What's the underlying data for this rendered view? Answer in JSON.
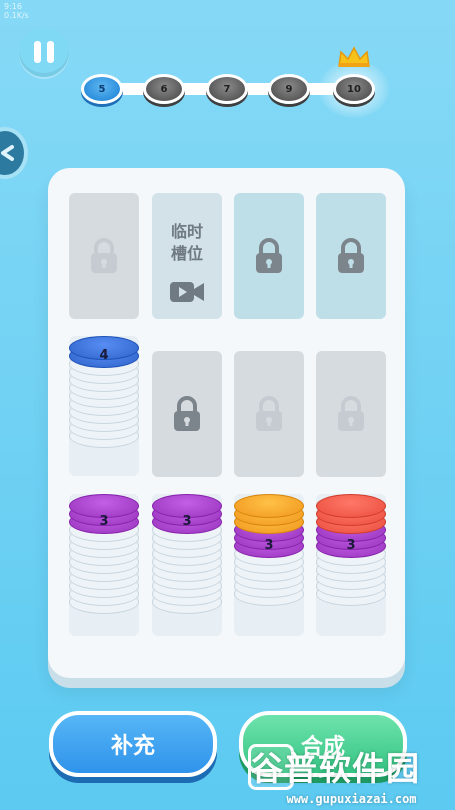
{
  "status_mini": {
    "line1": "9:16",
    "line2": "0.1K/s"
  },
  "levels": [
    {
      "label": "5",
      "state": "current"
    },
    {
      "label": "6",
      "state": "locked"
    },
    {
      "label": "7",
      "state": "locked"
    },
    {
      "label": "9",
      "state": "locked"
    },
    {
      "label": "10",
      "state": "boss"
    }
  ],
  "temp_slot": {
    "line1": "临时",
    "line2": "槽位"
  },
  "stacks": [
    {
      "top_label": "4",
      "top_color": "#3a6fd6",
      "colored_count": 2,
      "white_count": 10
    },
    {
      "top_label": "3",
      "top_color": "#a540c9",
      "colored_count": 3,
      "white_count": 10
    },
    {
      "top_label": "3",
      "top_color": "#a540c9",
      "colored_count": 3,
      "white_count": 10
    },
    {
      "top_label": "3",
      "top_color": "#a540c9",
      "colored_count": 3,
      "white_count": 6,
      "extra_top_color": "#f5a329",
      "extra_top_count": 3
    },
    {
      "top_label": "3",
      "top_color": "#a540c9",
      "colored_count": 3,
      "white_count": 6,
      "extra_top_color": "#f05a4a",
      "extra_top_count": 3
    }
  ],
  "buttons": {
    "refill": "补充",
    "merge": "合成"
  },
  "watermark": {
    "title": "谷普软件园",
    "url": "www.gupuxiazai.com"
  },
  "colors": {
    "accent_blue": "#2f93ea",
    "accent_green": "#36c484",
    "board": "#f4f8fa"
  }
}
